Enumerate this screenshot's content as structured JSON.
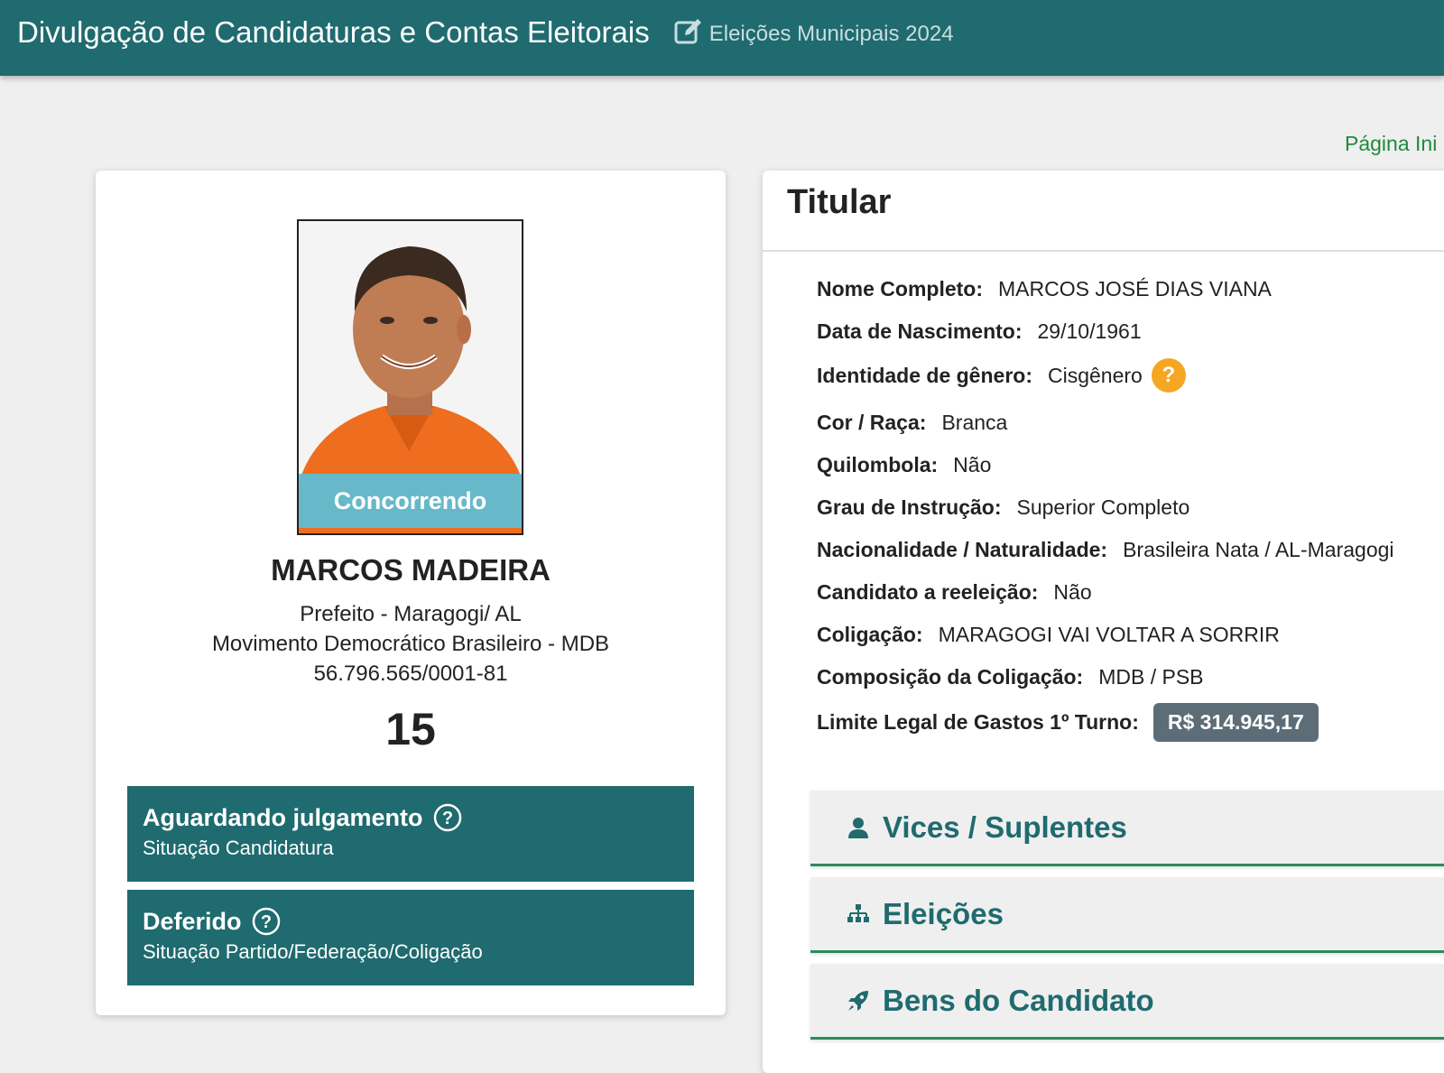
{
  "header": {
    "app_title": "Divulgação de Candidaturas e Contas Eleitorais",
    "election": "Eleições Municipais 2024",
    "icon": "edit-icon"
  },
  "nav": {
    "home_link": "Página Ini"
  },
  "candidate": {
    "status_ribbon": "Concorrendo",
    "name": "MARCOS MADEIRA",
    "office": "Prefeito - Maragogi/ AL",
    "party": "Movimento Democrático Brasileiro - MDB",
    "cnpj": "56.796.565/0001-81",
    "number": "15",
    "status_boxes": [
      {
        "title": "Aguardando julgamento",
        "subtitle": "Situação Candidatura"
      },
      {
        "title": "Deferido",
        "subtitle": "Situação Partido/Federação/Coligação"
      }
    ]
  },
  "titular": {
    "heading": "Titular",
    "fields": [
      {
        "label": "Nome Completo:",
        "value": "MARCOS JOSÉ DIAS VIANA"
      },
      {
        "label": "Data de Nascimento:",
        "value": "29/10/1961"
      },
      {
        "label": "Identidade de gênero:",
        "value": "Cisgênero",
        "help_badge": "?"
      },
      {
        "label": "Cor / Raça:",
        "value": "Branca"
      },
      {
        "label": "Quilombola:",
        "value": "Não"
      },
      {
        "label": "Grau de Instrução:",
        "value": "Superior Completo"
      },
      {
        "label": "Nacionalidade / Naturalidade:",
        "value": "Brasileira Nata / AL-Maragogi"
      },
      {
        "label": "Candidato a reeleição:",
        "value": "Não"
      },
      {
        "label": "Coligação:",
        "value": "MARAGOGI VAI VOLTAR A SORRIR"
      },
      {
        "label": "Composição da Coligação:",
        "value": "MDB / PSB"
      },
      {
        "label": "Limite Legal de Gastos 1º Turno:",
        "value": "R$ 314.945,17"
      }
    ]
  },
  "sections": [
    {
      "label": "Vices / Suplentes",
      "icon": "user-icon"
    },
    {
      "label": "Eleições",
      "icon": "sitemap-icon"
    },
    {
      "label": "Bens do Candidato",
      "icon": "rocket-icon"
    }
  ],
  "colors": {
    "primary": "#1f6b6f",
    "link_green": "#1e8a3c",
    "ribbon": "#5cbed6",
    "help_badge": "#f5a623",
    "money_badge": "#5c6d78"
  }
}
